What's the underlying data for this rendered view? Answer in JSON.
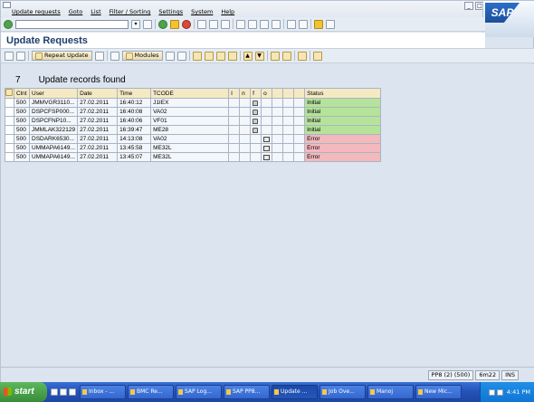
{
  "menu": {
    "items": [
      "Update requests",
      "Goto",
      "List",
      "Filter / Sorting",
      "Settings",
      "System",
      "Help"
    ]
  },
  "window": {
    "title": "Update Requests",
    "logo": "SAP"
  },
  "toolbar": {
    "buttons": [
      "Repeat Update",
      "Modules"
    ]
  },
  "result": {
    "count": "7",
    "label": "Update records found"
  },
  "table": {
    "headers": [
      "Clnt",
      "User",
      "Date",
      "Time",
      "TCODE",
      "I",
      "n",
      "f",
      "o",
      "",
      "",
      "",
      "Status"
    ],
    "rows": [
      {
        "clnt": "500",
        "user": "JMMVGR3110...",
        "date": "27.02.2011",
        "time": "16:40:12",
        "tcode": "J1IEX",
        "lock": "f",
        "status": "Initial",
        "kind": "initial"
      },
      {
        "clnt": "500",
        "user": "DSPCFSP000...",
        "date": "27.02.2011",
        "time": "16:40:08",
        "tcode": "VA02",
        "lock": "f",
        "status": "Initial",
        "kind": "initial"
      },
      {
        "clnt": "500",
        "user": "DSPCFNP10...",
        "date": "27.02.2011",
        "time": "16:40:06",
        "tcode": "VF01",
        "lock": "f",
        "status": "Initial",
        "kind": "initial"
      },
      {
        "clnt": "500",
        "user": "JMMLAK322129",
        "date": "27.02.2011",
        "time": "16:39:47",
        "tcode": "ME28",
        "lock": "f",
        "status": "Initial",
        "kind": "initial"
      },
      {
        "clnt": "500",
        "user": "DSDARK6530...",
        "date": "27.02.2011",
        "time": "14:13:08",
        "tcode": "VA02",
        "lock": "o",
        "status": "Error",
        "kind": "error"
      },
      {
        "clnt": "500",
        "user": "UMMAPA6149...",
        "date": "27.02.2011",
        "time": "13:45:58",
        "tcode": "ME32L",
        "lock": "o",
        "status": "Error",
        "kind": "error"
      },
      {
        "clnt": "500",
        "user": "UMMAPA6149...",
        "date": "27.02.2011",
        "time": "13:45:07",
        "tcode": "ME32L",
        "lock": "o",
        "status": "Error",
        "kind": "error"
      }
    ]
  },
  "statusbar": {
    "system": "PP8 (2) (500)",
    "server": "6m22",
    "mode": "INS"
  },
  "taskbar": {
    "start": "start",
    "tasks": [
      "Inbox - ...",
      "BMC Re...",
      "SAP Log...",
      "SAP PP8...",
      "Update ...",
      "Job Ove...",
      "Manoj",
      "New Mic..."
    ],
    "clock": "4:41 PM"
  },
  "colors": {
    "initial": "#b6e39a",
    "error": "#f3b9bd",
    "header": "#f5e9c4",
    "title": "#1d3d6d"
  }
}
